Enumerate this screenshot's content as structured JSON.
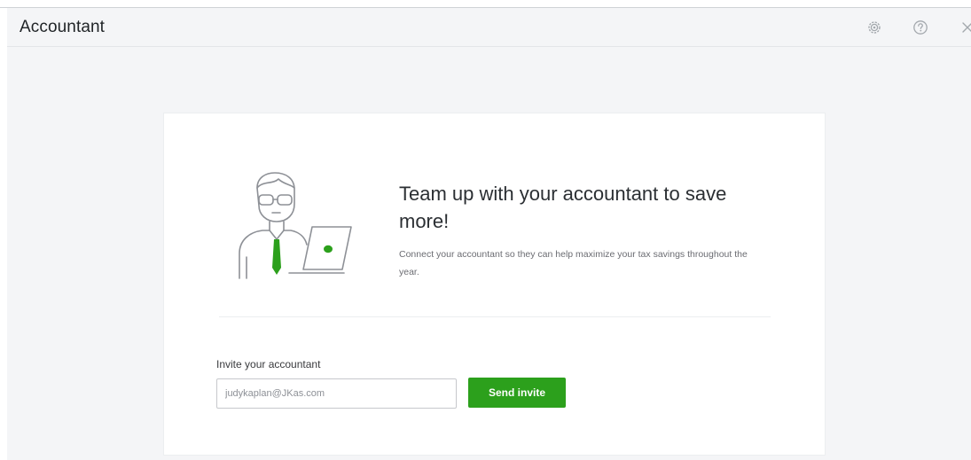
{
  "header": {
    "title": "Accountant",
    "icons": [
      "gear-icon",
      "help-icon",
      "close-icon"
    ]
  },
  "promo": {
    "headline": "Team up with your accountant to save more!",
    "subtext": "Connect your accountant so they can help maximize your tax savings throughout the year.",
    "illustration": "accountant-with-laptop"
  },
  "invite": {
    "label": "Invite your accountant",
    "email_value": "judykaplan@JKas.com",
    "send_label": "Send invite"
  },
  "colors": {
    "accent_green": "#2ca01c",
    "background": "#f4f5f7",
    "text_dark": "#393a3d"
  }
}
